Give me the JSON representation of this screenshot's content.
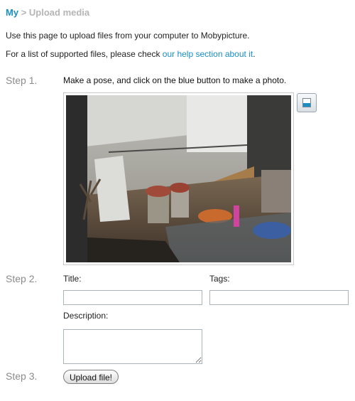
{
  "breadcrumb": {
    "root": "My",
    "separator": ">",
    "current": "Upload media"
  },
  "intro": {
    "line1": "Use this page to upload files from your computer to Mobypicture.",
    "line2_prefix": "For a list of supported files, please check ",
    "line2_link": "our help section about it",
    "line2_suffix": "."
  },
  "steps": {
    "step1": "Step 1.",
    "step2": "Step 2.",
    "step3": "Step 3."
  },
  "step1": {
    "instruction": "Make a pose, and click on the blue button to make a photo.",
    "camera_icon": "camera-capture-icon"
  },
  "form": {
    "title_label": "Title:",
    "title_value": "",
    "tags_label": "Tags:",
    "tags_value": "",
    "description_label": "Description:",
    "description_value": ""
  },
  "upload": {
    "button_label": "Upload file!"
  },
  "colors": {
    "accent": "#1a8fc2",
    "step_text": "#8a8a8a",
    "breadcrumb_muted": "#b5b5b5"
  }
}
